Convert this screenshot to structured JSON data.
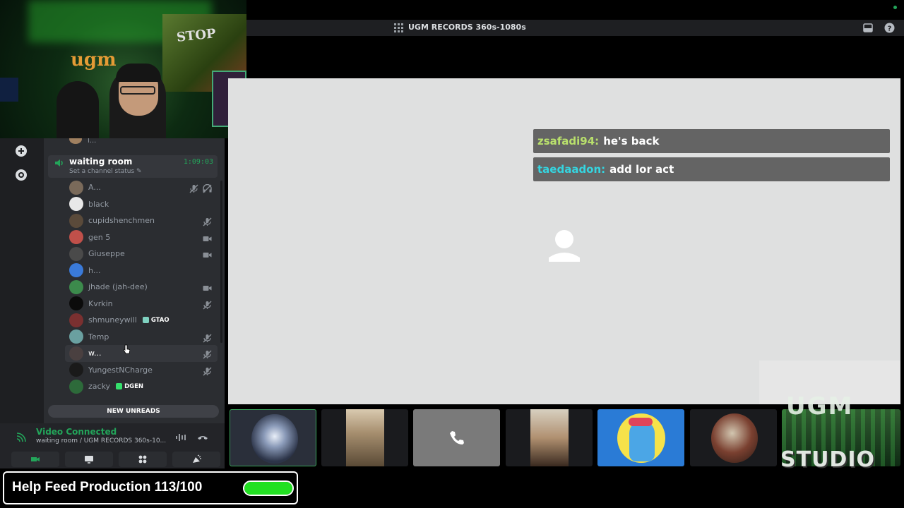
{
  "topbar": {
    "title": "UGM RECORDS 360s-1080s"
  },
  "channel": {
    "name": "waiting room",
    "timer": "1:09:03",
    "status_placeholder": "Set a channel status",
    "prev_member": "l..."
  },
  "members": [
    {
      "name": "A...",
      "icons": [
        "mute-icon",
        "deafen-icon"
      ]
    },
    {
      "name": "black",
      "icons": []
    },
    {
      "name": "cupidshenchmen",
      "icons": [
        "mute-icon"
      ]
    },
    {
      "name": "gen 5",
      "icons": [
        "camera-icon"
      ]
    },
    {
      "name": "Giuseppe",
      "icons": [
        "camera-icon"
      ]
    },
    {
      "name": "h...",
      "icons": []
    },
    {
      "name": "jhade (jah-dee)",
      "icons": [
        "camera-icon"
      ]
    },
    {
      "name": "Kvrkin",
      "icons": [
        "mute-icon"
      ]
    },
    {
      "name": "shmuneywill",
      "tag": "GTAO",
      "icons": []
    },
    {
      "name": "Temp",
      "icons": [
        "mute-icon"
      ]
    },
    {
      "name": "w...",
      "icons": [
        "mute-icon"
      ],
      "hover": true
    },
    {
      "name": "YungestNCharge",
      "icons": [
        "mute-icon"
      ]
    },
    {
      "name": "zacky",
      "tag": "DGEN",
      "icons": []
    }
  ],
  "new_unreads": "NEW UNREADS",
  "voice": {
    "title": "Video Connected",
    "subtitle": "waiting room / UGM RECORDS 360s-10..."
  },
  "chat": [
    {
      "user": "zsafadi94:",
      "text": "he's back",
      "color": "#b9e06c"
    },
    {
      "user": "taedaadon:",
      "text": "add lor act",
      "color": "#35d5e0"
    }
  ],
  "webcam": {
    "sign_text": "STOP",
    "graffiti_text": "ugm"
  },
  "studio_overlay": {
    "top": "UGM",
    "bottom": "STUDIO"
  },
  "goal": {
    "text": "Help Feed Production 113/100",
    "progress": 1.0
  }
}
